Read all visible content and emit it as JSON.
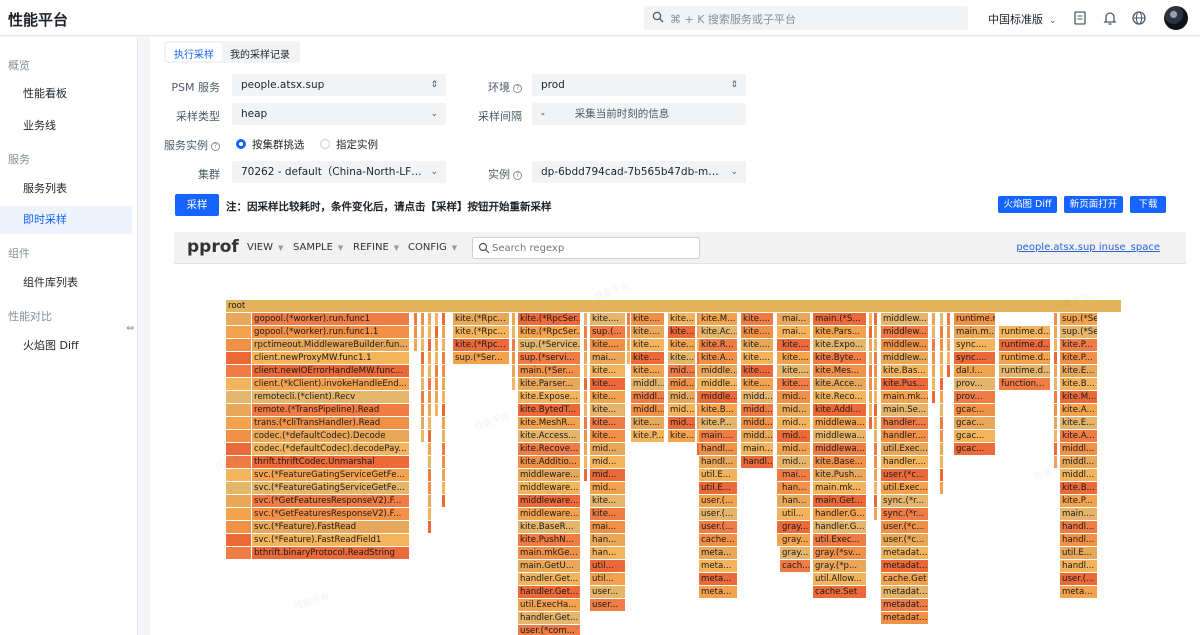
{
  "app": {
    "title": "性能平台"
  },
  "topbar": {
    "search_placeholder": "⌘ + K 搜索服务或子平台",
    "region": "中国标准版"
  },
  "sidebar": {
    "groups": [
      {
        "label": "概览",
        "items": [
          "性能看板",
          "业务线"
        ]
      },
      {
        "label": "服务",
        "items": [
          "服务列表",
          "即时采样"
        ]
      },
      {
        "label": "组件",
        "items": [
          "组件库列表"
        ]
      },
      {
        "label": "性能对比",
        "items": [
          "火焰图 Diff"
        ]
      }
    ],
    "active": "即时采样"
  },
  "tabs": [
    "执行采样",
    "我的采样记录"
  ],
  "form": {
    "psm_label": "PSM 服务",
    "psm_value": "people.atsx.sup",
    "env_label": "环境",
    "env_value": "prod",
    "type_label": "采样类型",
    "type_value": "heap",
    "interval_label": "采样间隔",
    "interval_value": "-",
    "interval_hint": "采集当前时刻的信息",
    "instance_label": "服务实例",
    "radio_cluster": "按集群挑选",
    "radio_specific": "指定实例",
    "cluster_label": "集群",
    "cluster_value": "70262 - default（China-North-LF | EE/...",
    "inst_label": "实例",
    "inst_value": "dp-6bdd794cad-7b565b47db-mmb8b ..."
  },
  "actions": {
    "sample": "采样",
    "note": "注：因采样比较耗时，条件变化后，请点击【采样】按钮开始重新采样",
    "flame_diff": "火焰图 Diff",
    "open_new": "新页面打开",
    "download": "下载"
  },
  "pprof": {
    "logo": "pprof",
    "menus": [
      "VIEW",
      "SAMPLE",
      "REFINE",
      "CONFIG"
    ],
    "search_placeholder": "Search regexp",
    "profile_link": "people.atsx.sup inuse_space"
  },
  "colors": {
    "accent": "#1664ff",
    "flame_hot": "#f0643c",
    "flame_warm": "#f5a04c",
    "flame_mild": "#e8b86a"
  },
  "flame": {
    "root": "root",
    "col1": [
      "gopool.(*worker).run.func1",
      "gopool.(*worker).run.func1.1",
      "rpctimeout.MiddlewareBuilder.fun...",
      "client.newProxyMW.func1.1",
      "client.newIOErrorHandleMW.func...",
      "client.(*kClient).invokeHandleEnd...",
      "remotecli.(*client).Recv",
      "remote.(*TransPipeline).Read",
      "trans.(*cliTransHandler).Read",
      "codec.(*defaultCodec).Decode",
      "codec.(*defaultCodec).decodePay...",
      "thrift.thriftCodec.Unmarshal",
      "svc.(*FeatureGatingServiceGetFe...",
      "svc.(*FeatureGatingServiceGetFe...",
      "svc.(*GetFeaturesResponseV2).F...",
      "svc.(*GetFeaturesResponseV2).F...",
      "svc.(*Feature).FastRead",
      "svc.(*Feature).FastReadField1",
      "bthrift.binaryProtocol.ReadString"
    ],
    "col2": [
      "kite.(*Rpc...",
      "kite.(*Rpc...",
      "kite.(*Rpc...",
      "sup.(*Ser..."
    ],
    "col3": [
      "kite.(*RpcSer...",
      "kite.(*RpcSer...",
      "sup.(*Service...",
      "sup.(*servi...",
      "main.(*Ser...",
      "kite.Parser...",
      "kite.Expose...",
      "kite.BytedT...",
      "kite.MeshR...",
      "kite.Access...",
      "kite.Recove...",
      "kite.Additio...",
      "middleware...",
      "middleware...",
      "middleware...",
      "middleware...",
      "kite.BaseR...",
      "kite.PushN...",
      "main.mkGe...",
      "main.GetU...",
      "handler.Get...",
      "handler.Get...",
      "util.ExecHa...",
      "handler.Get...",
      "user.(*com..."
    ],
    "col4": [
      "kite....",
      "sup.(...",
      "kite....",
      "mai...",
      "kite...",
      "kite...",
      "kite...",
      "kite...",
      "kite...",
      "kite...",
      "mid...",
      "mid...",
      "mid...",
      "mid...",
      "kite...",
      "kite...",
      "mai...",
      "han...",
      "han...",
      "util...",
      "util...",
      "user...",
      "user..."
    ],
    "col5": [
      "kite....",
      "kite....",
      "kite....",
      "kite....",
      "kite....",
      "middl...",
      "middl...",
      "middl...",
      "kite....",
      "kite.P..."
    ],
    "col6": [
      "kite....",
      "kite....",
      "kite....",
      "kite....",
      "mid...",
      "mid...",
      "mid...",
      "mid...",
      "mid...",
      "kite..."
    ],
    "col7": [
      "kite.M...",
      "kite.Ac...",
      "kite.R...",
      "kite.A...",
      "middle...",
      "middle...",
      "middle...",
      "kite.B...",
      "kite.P...",
      "main....",
      "handl...",
      "handl...",
      "util.E...",
      "util.E...",
      "user.(...",
      "user.(...",
      "user.(...",
      "cache...",
      "meta...",
      "meta...",
      "meta...",
      "meta..."
    ],
    "col8": [
      "kite....",
      "kite....",
      "kite....",
      "kite....",
      "kite....",
      "kite....",
      "midd...",
      "midd...",
      "midd...",
      "midd...",
      "main....",
      "handl..."
    ],
    "col9": [
      "mai...",
      "mai...",
      "kite....",
      "kite....",
      "kite....",
      "kite....",
      "mid...",
      "mid...",
      "mid...",
      "mid...",
      "mid...",
      "mid...",
      "mai...",
      "han...",
      "han...",
      "util...",
      "gray...",
      "gray...",
      "gray...",
      "cach..."
    ],
    "col10": [
      "main.(*S...",
      "kite.Pars...",
      "kite.Expo...",
      "kite.Byte...",
      "kite.Mes...",
      "kite.Acce...",
      "kite.Reco...",
      "kite.Addi...",
      "middlewa...",
      "middlewa...",
      "middlewa...",
      "kite.Base...",
      "kite.Push...",
      "main.mk...",
      "main.Get...",
      "handler.G...",
      "handler.G...",
      "util.Exec...",
      "gray.(*sv...",
      "gray.(*p...",
      "util.Allow...",
      "cache.Set"
    ],
    "col11": [
      "middlew...",
      "middlew...",
      "middlew...",
      "middlew...",
      "kite.Bas...",
      "kite.Pus...",
      "main.mk...",
      "main.Se...",
      "handler....",
      "handler....",
      "util.Exec...",
      "handler....",
      "user.(*c...",
      "util.Exec...",
      "sync.(*r...",
      "sync.(*r...",
      "user.(*c...",
      "user.(*c...",
      "metadat...",
      "metadat...",
      "cache.Get",
      "metadat...",
      "metadat...",
      "metadat..."
    ],
    "col12": [
      "runtime.main",
      "main.m...",
      "sync....",
      "sync....",
      "dal.I...",
      "prov...",
      "prov...",
      "gcac...",
      "gcac...",
      "gcac...",
      "gcac..."
    ],
    "col13": [
      "runtime.d...",
      "runtime.d...",
      "runtime.d...",
      "runtime.d...",
      "function..."
    ],
    "col14": [
      "sup.(*Se...",
      "sup.(*Se...",
      "kite.P...",
      "kite.P...",
      "kite.E...",
      "kite.B...",
      "kite.M...",
      "kite.A...",
      "kite.E...",
      "kite.A...",
      "middl...",
      "middl...",
      "middl...",
      "kite.B...",
      "kite.P...",
      "main....",
      "handl...",
      "handl...",
      "util.E...",
      "handl...",
      "user.(...",
      "meta..."
    ]
  }
}
